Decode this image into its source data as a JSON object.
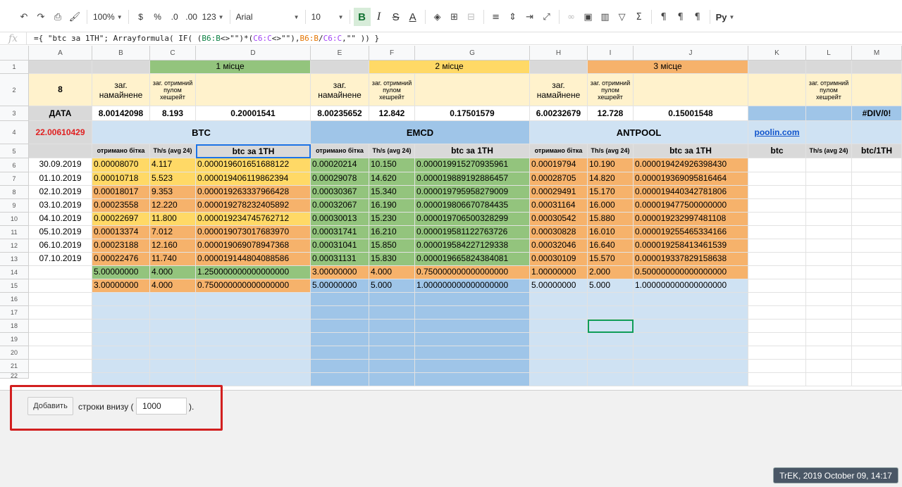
{
  "toolbar": {
    "zoom": "100%",
    "currency": "$",
    "percent": "%",
    "dec_less": ".0",
    "dec_more": ".00",
    "format": "123",
    "font": "Arial",
    "font_size": "10",
    "bold": "B",
    "italic": "I",
    "strike": "S",
    "text_color": "A",
    "script_label": "Py"
  },
  "formula_bar": {
    "fx": "fx",
    "parts": [
      "={ \"btc за 1TH\"; Arrayformula( IF( (",
      "B6:B",
      "<>\"\")*(",
      "C6:C",
      "<>\"\"),",
      "B6:B",
      "/",
      "C6:C",
      ",\"\" )) }"
    ]
  },
  "columns": [
    "A",
    "B",
    "C",
    "D",
    "E",
    "F",
    "G",
    "H",
    "I",
    "J",
    "K",
    "L",
    "M"
  ],
  "rows": [
    "1",
    "2",
    "3",
    "4",
    "5",
    "6",
    "7",
    "8",
    "9",
    "10",
    "11",
    "12",
    "13",
    "14",
    "15",
    "16",
    "17",
    "18",
    "19",
    "20",
    "21",
    "22"
  ],
  "sheet": {
    "r1": {
      "d": "1 місце",
      "g": "2 місце",
      "j": "3 місце"
    },
    "r2": {
      "a": "8",
      "b": "заг. намайнене",
      "c": "заг. отримний пулом хешрейт",
      "e": "заг. намайнене",
      "f": "заг. отримний пулом хешрейт",
      "h": "заг. намайнене",
      "i": "заг. отримний пулом хешрейт",
      "l": "заг. отримний пулом хешрейт"
    },
    "r3": {
      "a": "ДАТА",
      "b": "8.00142098",
      "c": "8.193",
      "d": "0.20001541",
      "e": "8.00235652",
      "f": "12.842",
      "g": "0.17501579",
      "h": "6.00232679",
      "i": "12.728",
      "j": "0.15001548",
      "m": "#DIV/0!"
    },
    "r4": {
      "a": "22.00610429",
      "btc": "BTC",
      "emcd": "EMCD",
      "antpool": "ANTPOOL",
      "k": "poolin.com"
    },
    "r5": {
      "b": "отримано бітка",
      "c": "Th/s (avg 24)",
      "d": "btc за 1TH",
      "e": "отримано бітка",
      "f": "Th/s (avg 24)",
      "g": "btc за 1TH",
      "h": "отримано бітка",
      "i": "Th/s (avg 24)",
      "j": "btc за 1TH",
      "k": "btc",
      "l": "Th/s (avg 24)",
      "m": "btc/1TH"
    },
    "data": [
      {
        "a": "30.09.2019",
        "b": "0.00008070",
        "c": "4.117",
        "d": "0.000019601651688122",
        "e": "0.00020214",
        "f": "10.150",
        "g": "0.000019915270935961",
        "h": "0.00019794",
        "i": "10.190",
        "j": "0.000019424926398430"
      },
      {
        "a": "01.10.2019",
        "b": "0.00010718",
        "c": "5.523",
        "d": "0.000019406119862394",
        "e": "0.00029078",
        "f": "14.620",
        "g": "0.000019889192886457",
        "h": "0.00028705",
        "i": "14.820",
        "j": "0.000019369095816464"
      },
      {
        "a": "02.10.2019",
        "b": "0.00018017",
        "c": "9.353",
        "d": "0.000019263337966428",
        "e": "0.00030367",
        "f": "15.340",
        "g": "0.000019795958279009",
        "h": "0.00029491",
        "i": "15.170",
        "j": "0.000019440342781806"
      },
      {
        "a": "03.10.2019",
        "b": "0.00023558",
        "c": "12.220",
        "d": "0.000019278232405892",
        "e": "0.00032067",
        "f": "16.190",
        "g": "0.000019806670784435",
        "h": "0.00031164",
        "i": "16.000",
        "j": "0.000019477500000000"
      },
      {
        "a": "04.10.2019",
        "b": "0.00022697",
        "c": "11.800",
        "d": "0.000019234745762712",
        "e": "0.00030013",
        "f": "15.230",
        "g": "0.000019706500328299",
        "h": "0.00030542",
        "i": "15.880",
        "j": "0.000019232997481108"
      },
      {
        "a": "05.10.2019",
        "b": "0.00013374",
        "c": "7.012",
        "d": "0.000019073017683970",
        "e": "0.00031741",
        "f": "16.210",
        "g": "0.000019581122763726",
        "h": "0.00030828",
        "i": "16.010",
        "j": "0.000019255465334166"
      },
      {
        "a": "06.10.2019",
        "b": "0.00023188",
        "c": "12.160",
        "d": "0.000019069078947368",
        "e": "0.00031041",
        "f": "15.850",
        "g": "0.000019584227129338",
        "h": "0.00032046",
        "i": "16.640",
        "j": "0.000019258413461539"
      },
      {
        "a": "07.10.2019",
        "b": "0.00022476",
        "c": "11.740",
        "d": "0.000019144804088586",
        "e": "0.00031131",
        "f": "15.830",
        "g": "0.000019665824384081",
        "h": "0.00030109",
        "i": "15.570",
        "j": "0.000019337829158638"
      },
      {
        "a": "",
        "b": "5.00000000",
        "c": "4.000",
        "d": "1.250000000000000000",
        "e": "3.00000000",
        "f": "4.000",
        "g": "0.750000000000000000",
        "h": "1.00000000",
        "i": "2.000",
        "j": "0.500000000000000000"
      },
      {
        "a": "",
        "b": "3.00000000",
        "c": "4.000",
        "d": "0.750000000000000000",
        "e": "5.00000000",
        "f": "5.000",
        "g": "1.000000000000000000",
        "h": "5.00000000",
        "i": "5.000",
        "j": "1.000000000000000000"
      }
    ]
  },
  "bottom": {
    "add_button": "Добавить",
    "rows_label": "строки внизу (",
    "rows_value": "1000",
    "rows_end": ")."
  },
  "watermark": "TrEK, 2019 October 09, 14:17",
  "colors": {
    "green": "#93c47d",
    "yellow": "#ffd966",
    "orange": "#f6b26b",
    "lightblue": "#cfe2f3",
    "blue": "#9fc5e8",
    "cream": "#fff2cc",
    "grey": "#d9d9d9",
    "red_text": "#e02020"
  }
}
